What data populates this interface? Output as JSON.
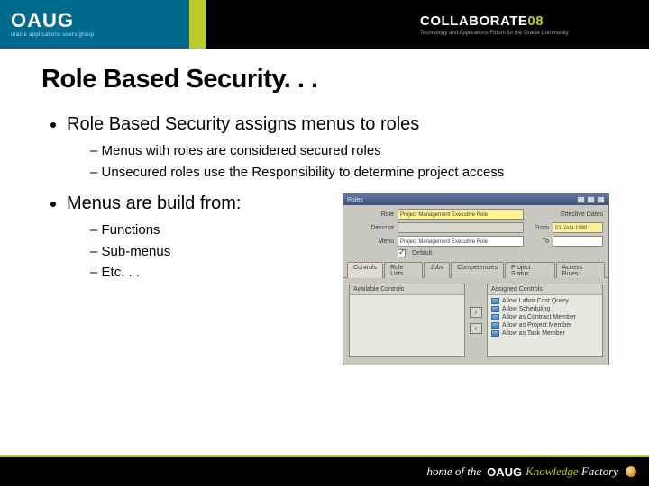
{
  "header": {
    "org": "OAUG",
    "org_tag": "oracle applications users group",
    "event": "COLLABORATE",
    "event_year": "08",
    "event_sub": "Technology and Applications Forum for the Oracle Community"
  },
  "title": "Role Based Security. . .",
  "bullets": [
    {
      "text": "Role Based Security assigns menus to roles",
      "sub": [
        "Menus with roles are considered secured roles",
        "Unsecured roles use the Responsibility to determine project access"
      ]
    },
    {
      "text": "Menus are build from:",
      "sub": [
        "Functions",
        "Sub-menus",
        "Etc. . ."
      ]
    }
  ],
  "app": {
    "window_title": "Roles",
    "fields": {
      "role_label": "Role",
      "role_value": "Project Management Executive Role",
      "descr_label": "Descript",
      "menu_label": "Menu",
      "menu_value": "Project Management Executive Role",
      "eff_label": "Effective Dates",
      "from_label": "From",
      "from_value": "01-JAN-1980",
      "to_label": "To",
      "default_checkbox": "Default"
    },
    "tabs": [
      "Controls",
      "Role Lists",
      "Jobs",
      "Competencies",
      "Project Status",
      "Access Rules"
    ],
    "available_header": "Available Controls",
    "assigned_header": "Assigned Controls",
    "assigned_items": [
      "Allow Labor Cost Query",
      "Allow Scheduling",
      "Allow as Contract Member",
      "Allow as Project Member",
      "Allow as Task Member"
    ]
  },
  "footer": {
    "home": "home of the",
    "brand": "OAUG",
    "kf1": "Knowledge",
    "kf2": "Factory"
  }
}
